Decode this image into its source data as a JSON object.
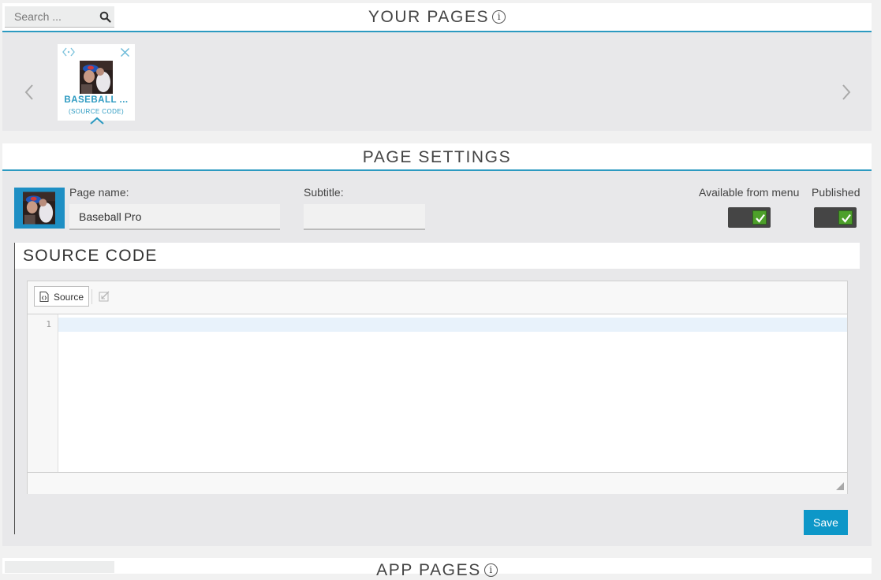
{
  "search": {
    "placeholder": "Search ..."
  },
  "your_pages": {
    "title": "YOUR PAGES",
    "info_glyph": "i",
    "cards": [
      {
        "title": "BASEBALL ...",
        "subtitle": "(SOURCE CODE)"
      }
    ]
  },
  "page_settings": {
    "title": "PAGE SETTINGS",
    "page_name_label": "Page name:",
    "page_name_value": "Baseball Pro",
    "subtitle_label": "Subtitle:",
    "subtitle_value": "",
    "menu_label": "Available from menu",
    "menu_checked": true,
    "published_label": "Published",
    "published_checked": true
  },
  "source_code": {
    "title": "SOURCE CODE",
    "source_button_label": "Source",
    "line_numbers": [
      "1"
    ],
    "code": ""
  },
  "save_label": "Save",
  "next_section": {
    "title": "APP PAGES"
  },
  "colors": {
    "accent": "#2c9ac1",
    "save": "#0d97c8",
    "toggle_bg": "#454545",
    "check": "#4da02a"
  }
}
